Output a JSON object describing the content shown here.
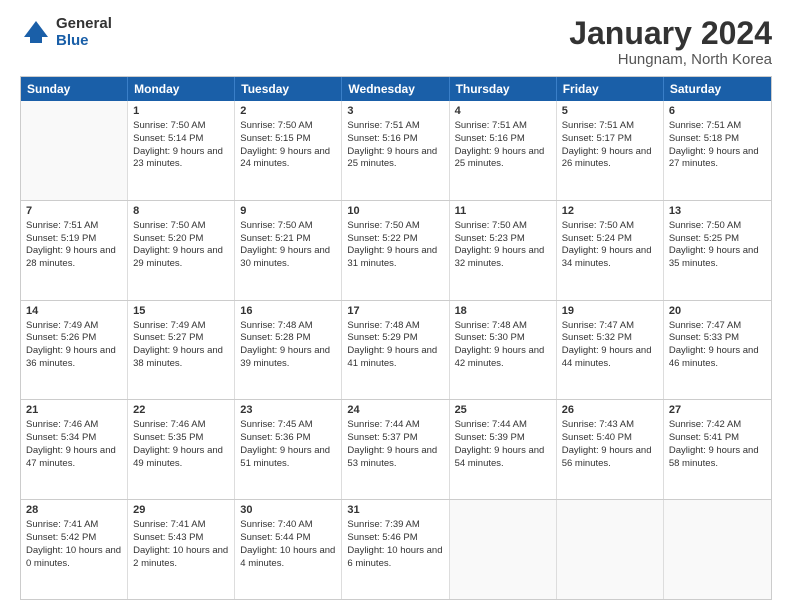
{
  "header": {
    "logo_general": "General",
    "logo_blue": "Blue",
    "month_year": "January 2024",
    "location": "Hungnam, North Korea"
  },
  "days_of_week": [
    "Sunday",
    "Monday",
    "Tuesday",
    "Wednesday",
    "Thursday",
    "Friday",
    "Saturday"
  ],
  "weeks": [
    [
      {
        "day": "",
        "sunrise": "",
        "sunset": "",
        "daylight": ""
      },
      {
        "day": "1",
        "sunrise": "Sunrise: 7:50 AM",
        "sunset": "Sunset: 5:14 PM",
        "daylight": "Daylight: 9 hours and 23 minutes."
      },
      {
        "day": "2",
        "sunrise": "Sunrise: 7:50 AM",
        "sunset": "Sunset: 5:15 PM",
        "daylight": "Daylight: 9 hours and 24 minutes."
      },
      {
        "day": "3",
        "sunrise": "Sunrise: 7:51 AM",
        "sunset": "Sunset: 5:16 PM",
        "daylight": "Daylight: 9 hours and 25 minutes."
      },
      {
        "day": "4",
        "sunrise": "Sunrise: 7:51 AM",
        "sunset": "Sunset: 5:16 PM",
        "daylight": "Daylight: 9 hours and 25 minutes."
      },
      {
        "day": "5",
        "sunrise": "Sunrise: 7:51 AM",
        "sunset": "Sunset: 5:17 PM",
        "daylight": "Daylight: 9 hours and 26 minutes."
      },
      {
        "day": "6",
        "sunrise": "Sunrise: 7:51 AM",
        "sunset": "Sunset: 5:18 PM",
        "daylight": "Daylight: 9 hours and 27 minutes."
      }
    ],
    [
      {
        "day": "7",
        "sunrise": "Sunrise: 7:51 AM",
        "sunset": "Sunset: 5:19 PM",
        "daylight": "Daylight: 9 hours and 28 minutes."
      },
      {
        "day": "8",
        "sunrise": "Sunrise: 7:50 AM",
        "sunset": "Sunset: 5:20 PM",
        "daylight": "Daylight: 9 hours and 29 minutes."
      },
      {
        "day": "9",
        "sunrise": "Sunrise: 7:50 AM",
        "sunset": "Sunset: 5:21 PM",
        "daylight": "Daylight: 9 hours and 30 minutes."
      },
      {
        "day": "10",
        "sunrise": "Sunrise: 7:50 AM",
        "sunset": "Sunset: 5:22 PM",
        "daylight": "Daylight: 9 hours and 31 minutes."
      },
      {
        "day": "11",
        "sunrise": "Sunrise: 7:50 AM",
        "sunset": "Sunset: 5:23 PM",
        "daylight": "Daylight: 9 hours and 32 minutes."
      },
      {
        "day": "12",
        "sunrise": "Sunrise: 7:50 AM",
        "sunset": "Sunset: 5:24 PM",
        "daylight": "Daylight: 9 hours and 34 minutes."
      },
      {
        "day": "13",
        "sunrise": "Sunrise: 7:50 AM",
        "sunset": "Sunset: 5:25 PM",
        "daylight": "Daylight: 9 hours and 35 minutes."
      }
    ],
    [
      {
        "day": "14",
        "sunrise": "Sunrise: 7:49 AM",
        "sunset": "Sunset: 5:26 PM",
        "daylight": "Daylight: 9 hours and 36 minutes."
      },
      {
        "day": "15",
        "sunrise": "Sunrise: 7:49 AM",
        "sunset": "Sunset: 5:27 PM",
        "daylight": "Daylight: 9 hours and 38 minutes."
      },
      {
        "day": "16",
        "sunrise": "Sunrise: 7:48 AM",
        "sunset": "Sunset: 5:28 PM",
        "daylight": "Daylight: 9 hours and 39 minutes."
      },
      {
        "day": "17",
        "sunrise": "Sunrise: 7:48 AM",
        "sunset": "Sunset: 5:29 PM",
        "daylight": "Daylight: 9 hours and 41 minutes."
      },
      {
        "day": "18",
        "sunrise": "Sunrise: 7:48 AM",
        "sunset": "Sunset: 5:30 PM",
        "daylight": "Daylight: 9 hours and 42 minutes."
      },
      {
        "day": "19",
        "sunrise": "Sunrise: 7:47 AM",
        "sunset": "Sunset: 5:32 PM",
        "daylight": "Daylight: 9 hours and 44 minutes."
      },
      {
        "day": "20",
        "sunrise": "Sunrise: 7:47 AM",
        "sunset": "Sunset: 5:33 PM",
        "daylight": "Daylight: 9 hours and 46 minutes."
      }
    ],
    [
      {
        "day": "21",
        "sunrise": "Sunrise: 7:46 AM",
        "sunset": "Sunset: 5:34 PM",
        "daylight": "Daylight: 9 hours and 47 minutes."
      },
      {
        "day": "22",
        "sunrise": "Sunrise: 7:46 AM",
        "sunset": "Sunset: 5:35 PM",
        "daylight": "Daylight: 9 hours and 49 minutes."
      },
      {
        "day": "23",
        "sunrise": "Sunrise: 7:45 AM",
        "sunset": "Sunset: 5:36 PM",
        "daylight": "Daylight: 9 hours and 51 minutes."
      },
      {
        "day": "24",
        "sunrise": "Sunrise: 7:44 AM",
        "sunset": "Sunset: 5:37 PM",
        "daylight": "Daylight: 9 hours and 53 minutes."
      },
      {
        "day": "25",
        "sunrise": "Sunrise: 7:44 AM",
        "sunset": "Sunset: 5:39 PM",
        "daylight": "Daylight: 9 hours and 54 minutes."
      },
      {
        "day": "26",
        "sunrise": "Sunrise: 7:43 AM",
        "sunset": "Sunset: 5:40 PM",
        "daylight": "Daylight: 9 hours and 56 minutes."
      },
      {
        "day": "27",
        "sunrise": "Sunrise: 7:42 AM",
        "sunset": "Sunset: 5:41 PM",
        "daylight": "Daylight: 9 hours and 58 minutes."
      }
    ],
    [
      {
        "day": "28",
        "sunrise": "Sunrise: 7:41 AM",
        "sunset": "Sunset: 5:42 PM",
        "daylight": "Daylight: 10 hours and 0 minutes."
      },
      {
        "day": "29",
        "sunrise": "Sunrise: 7:41 AM",
        "sunset": "Sunset: 5:43 PM",
        "daylight": "Daylight: 10 hours and 2 minutes."
      },
      {
        "day": "30",
        "sunrise": "Sunrise: 7:40 AM",
        "sunset": "Sunset: 5:44 PM",
        "daylight": "Daylight: 10 hours and 4 minutes."
      },
      {
        "day": "31",
        "sunrise": "Sunrise: 7:39 AM",
        "sunset": "Sunset: 5:46 PM",
        "daylight": "Daylight: 10 hours and 6 minutes."
      },
      {
        "day": "",
        "sunrise": "",
        "sunset": "",
        "daylight": ""
      },
      {
        "day": "",
        "sunrise": "",
        "sunset": "",
        "daylight": ""
      },
      {
        "day": "",
        "sunrise": "",
        "sunset": "",
        "daylight": ""
      }
    ]
  ]
}
